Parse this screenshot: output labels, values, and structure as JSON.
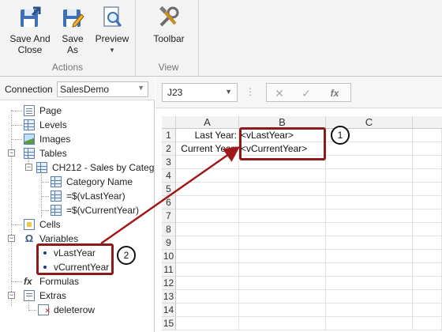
{
  "ribbon": {
    "actions": {
      "save_and_close": "Save And\nClose",
      "save_as": "Save\nAs",
      "preview": "Preview",
      "group_label": "Actions"
    },
    "view": {
      "toolbar": "Toolbar",
      "group_label": "View"
    }
  },
  "connection": {
    "label": "Connection",
    "value": "SalesDemo"
  },
  "tree": {
    "page": "Page",
    "levels": "Levels",
    "images": "Images",
    "tables": "Tables",
    "table_name": "CH212 - Sales by Categ",
    "category_name": "Category Name",
    "col_last_year": "=$(vLastYear)",
    "col_current_year": "=$(vCurrentYear)",
    "cells": "Cells",
    "variables": "Variables",
    "var_last_year": "vLastYear",
    "var_current_year": "vCurrentYear",
    "formulas": "Formulas",
    "extras": "Extras",
    "deleterow": "deleterow"
  },
  "formula_bar": {
    "cell_ref": "J23",
    "dots": "⋮",
    "fx": "fx"
  },
  "sheet": {
    "columns": [
      "A",
      "B",
      "C"
    ],
    "rows": [
      "1",
      "2",
      "3",
      "4",
      "5",
      "6",
      "7",
      "8",
      "9",
      "10",
      "11",
      "12",
      "13",
      "14",
      "15"
    ],
    "cells": {
      "a1": "Last Year:",
      "b1": "<vLastYear>",
      "a2": "Current Year:",
      "b2": "<vCurrentYear>"
    }
  },
  "callouts": {
    "one": "1",
    "two": "2"
  },
  "colors": {
    "callout_border": "#8b1a1a",
    "arrow": "#a01818"
  }
}
